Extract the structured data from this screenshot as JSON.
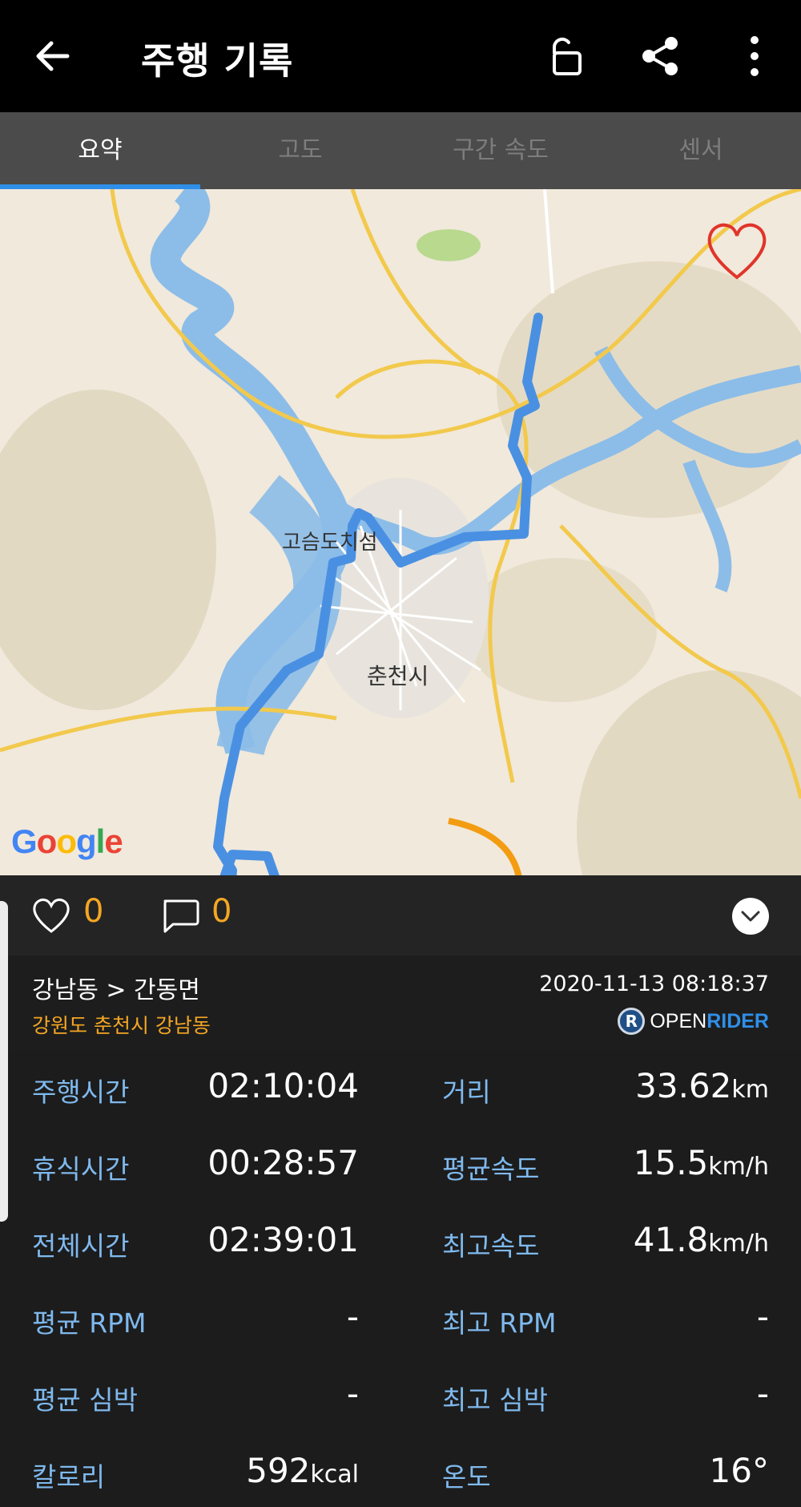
{
  "appbar": {
    "title": "주행 기록",
    "back_icon": "arrow-left-icon",
    "lock_icon": "unlock-icon",
    "share_icon": "share-icon",
    "more_icon": "more-vert-icon"
  },
  "tabs": [
    {
      "label": "요약",
      "active": true
    },
    {
      "label": "고도",
      "active": false
    },
    {
      "label": "구간 속도",
      "active": false
    },
    {
      "label": "센서",
      "active": false
    }
  ],
  "map": {
    "labels": [
      "고슴도치섬",
      "춘천시"
    ],
    "provider": "Google",
    "route_color": "#4a90e2",
    "secondary_route_color": "#f39c12"
  },
  "social": {
    "like_count": "0",
    "comment_count": "0"
  },
  "route": {
    "name": "강남동 > 간동면",
    "address": "강원도 춘천시 강남동",
    "datetime": "2020-11-13 08:18:37",
    "brand_open": "OPEN",
    "brand_rider": "RIDER",
    "brand_mark": "R"
  },
  "stats": [
    {
      "left_label": "주행시간",
      "left_value": "02:10:04",
      "left_unit": "",
      "right_label": "거리",
      "right_value": "33.62",
      "right_unit": "km"
    },
    {
      "left_label": "휴식시간",
      "left_value": "00:28:57",
      "left_unit": "",
      "right_label": "평균속도",
      "right_value": "15.5",
      "right_unit": "km/h"
    },
    {
      "left_label": "전체시간",
      "left_value": "02:39:01",
      "left_unit": "",
      "right_label": "최고속도",
      "right_value": "41.8",
      "right_unit": "km/h"
    },
    {
      "left_label": "평균 RPM",
      "left_value": "-",
      "left_unit": "",
      "right_label": "최고 RPM",
      "right_value": "-",
      "right_unit": ""
    },
    {
      "left_label": "평균 심박",
      "left_value": "-",
      "left_unit": "",
      "right_label": "최고 심박",
      "right_value": "-",
      "right_unit": ""
    },
    {
      "left_label": "칼로리",
      "left_value": "592",
      "left_unit": "kcal",
      "right_label": "온도",
      "right_value": "16°",
      "right_unit": ""
    }
  ]
}
